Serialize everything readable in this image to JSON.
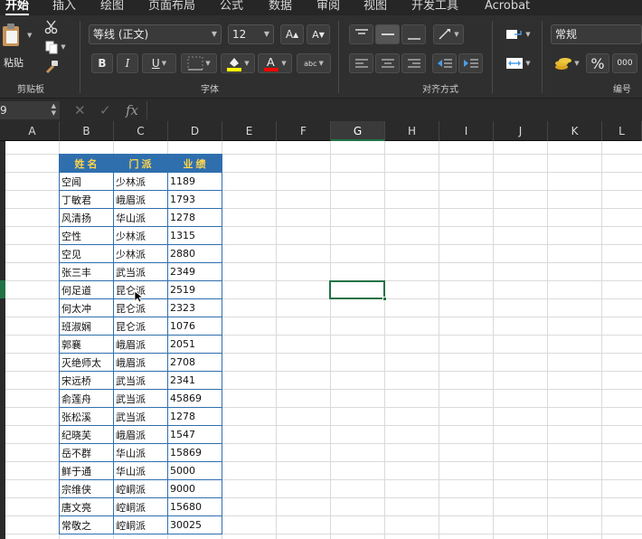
{
  "ribbon": {
    "tabs": [
      "开始",
      "插入",
      "绘图",
      "页面布局",
      "公式",
      "数据",
      "审阅",
      "视图",
      "开发工具",
      "Acrobat"
    ],
    "active_tab": "开始",
    "clipboard": {
      "paste_label": "粘贴",
      "group_label": "剪贴板"
    },
    "font": {
      "name": "等线 (正文)",
      "size": "12",
      "group_label": "字体",
      "bold": "B",
      "italic": "I",
      "underline": "U",
      "font_color": "#ff0000",
      "fill_color": "#ffff00",
      "grow_label": "A",
      "shrink_label": "A",
      "abc_label": "abc"
    },
    "alignment": {
      "group_label": "对齐方式"
    },
    "number": {
      "format": "常规",
      "group_label": "编号",
      "percent": "%",
      "thousands": "000"
    }
  },
  "formula_bar": {
    "name_box": "9",
    "fx": "fx",
    "formula": ""
  },
  "columns": [
    "A",
    "B",
    "C",
    "D",
    "E",
    "F",
    "G",
    "H",
    "I",
    "J",
    "K",
    "L"
  ],
  "selected_column": "G",
  "table": {
    "headers": [
      "姓名",
      "门派",
      "业绩"
    ],
    "rows": [
      [
        "空闻",
        "少林派",
        "1189"
      ],
      [
        "丁敏君",
        "峨眉派",
        "1793"
      ],
      [
        "风清扬",
        "华山派",
        "1278"
      ],
      [
        "空性",
        "少林派",
        "1315"
      ],
      [
        "空见",
        "少林派",
        "2880"
      ],
      [
        "张三丰",
        "武当派",
        "2349"
      ],
      [
        "何足道",
        "昆仑派",
        "2519"
      ],
      [
        "何太冲",
        "昆仑派",
        "2323"
      ],
      [
        "班淑娴",
        "昆仑派",
        "1076"
      ],
      [
        "郭襄",
        "峨眉派",
        "2051"
      ],
      [
        "灭绝师太",
        "峨眉派",
        "2708"
      ],
      [
        "宋远桥",
        "武当派",
        "2341"
      ],
      [
        "俞莲舟",
        "武当派",
        "45869"
      ],
      [
        "张松溪",
        "武当派",
        "1278"
      ],
      [
        "纪晓芙",
        "峨眉派",
        "1547"
      ],
      [
        "岳不群",
        "华山派",
        "15869"
      ],
      [
        "鲜于通",
        "华山派",
        "5000"
      ],
      [
        "宗维侠",
        "崆峒派",
        "9000"
      ],
      [
        "唐文亮",
        "崆峒派",
        "15680"
      ],
      [
        "常敬之",
        "崆峒派",
        "30025"
      ]
    ]
  },
  "colors": {
    "header_bg": "#2f6fae",
    "header_text": "#ffd64a",
    "accent": "#217346"
  }
}
